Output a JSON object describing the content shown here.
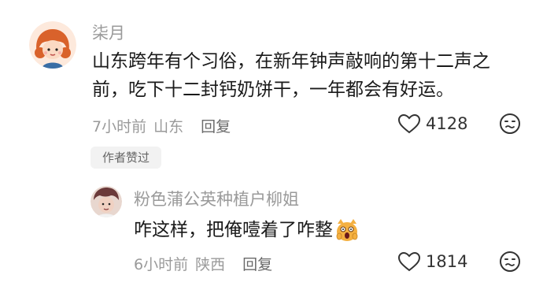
{
  "comment": {
    "username": "柒月",
    "text_line1": "山东跨年有个习俗，在新年钟声敲响的第十二声之",
    "text_line2": "前，吃下十二封钙奶饼干，一年都会有好运。",
    "time": "7小时前",
    "location": "山东",
    "reply_label": "回复",
    "like_count": "4128",
    "author_badge": "作者赞过"
  },
  "reply": {
    "username": "粉色蒲公英种植户柳姐",
    "text": "咋这样，把俺噎着了咋整",
    "time": "6小时前",
    "location": "陕西",
    "reply_label": "回复",
    "like_count": "1814"
  },
  "icons": [
    "heart-icon",
    "dislike-face-icon",
    "scream-cat-emoji"
  ]
}
